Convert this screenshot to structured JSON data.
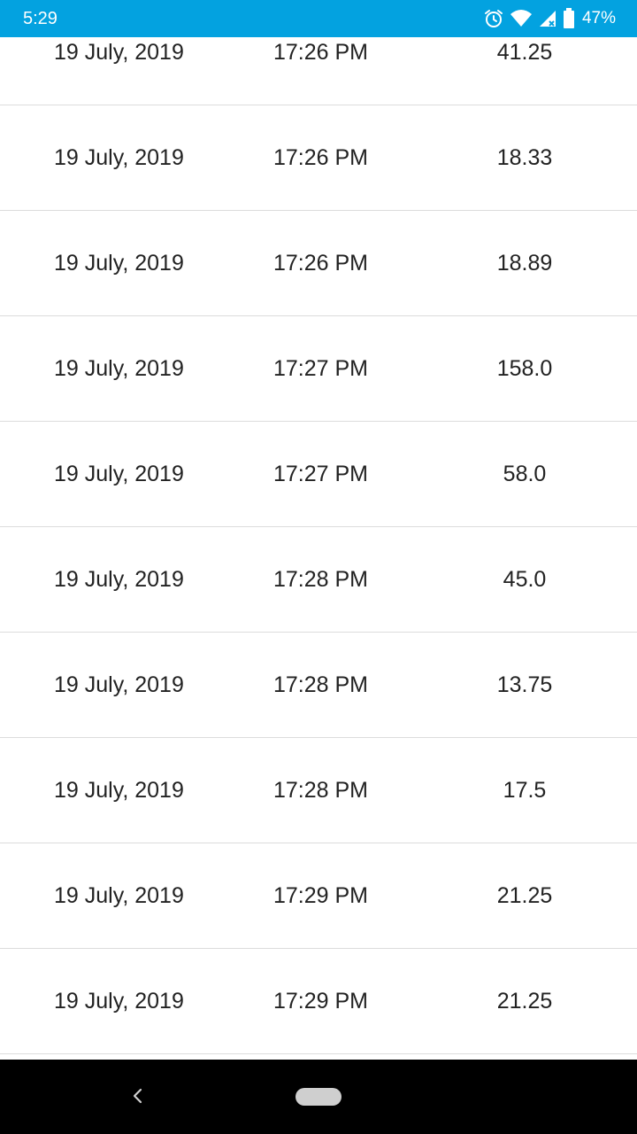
{
  "status_bar": {
    "time": "5:29",
    "battery_percent": "47%",
    "icons": [
      "alarm-icon",
      "wifi-icon",
      "cell-signal-icon",
      "battery-icon"
    ],
    "background_color": "#03a2e0"
  },
  "table": {
    "rows": [
      {
        "date": "19 July, 2019",
        "time": "17:26 PM",
        "value": "41.25"
      },
      {
        "date": "19 July, 2019",
        "time": "17:26 PM",
        "value": "18.33"
      },
      {
        "date": "19 July, 2019",
        "time": "17:26 PM",
        "value": "18.89"
      },
      {
        "date": "19 July, 2019",
        "time": "17:27 PM",
        "value": "158.0"
      },
      {
        "date": "19 July, 2019",
        "time": "17:27 PM",
        "value": "58.0"
      },
      {
        "date": "19 July, 2019",
        "time": "17:28 PM",
        "value": "45.0"
      },
      {
        "date": "19 July, 2019",
        "time": "17:28 PM",
        "value": "13.75"
      },
      {
        "date": "19 July, 2019",
        "time": "17:28 PM",
        "value": "17.5"
      },
      {
        "date": "19 July, 2019",
        "time": "17:29 PM",
        "value": "21.25"
      },
      {
        "date": "19 July, 2019",
        "time": "17:29 PM",
        "value": "21.25"
      }
    ]
  },
  "nav_bar": {
    "buttons": [
      "back-icon",
      "home-pill-icon"
    ]
  }
}
